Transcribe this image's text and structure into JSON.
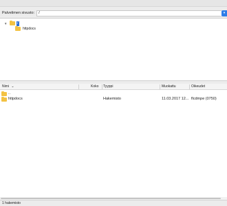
{
  "path_bar": {
    "label": "Palvelimen sivusto:",
    "value": "/",
    "dropdown_icon": "chevron-down-icon"
  },
  "tree": {
    "root_label": "/",
    "children": [
      {
        "label": "httpdocs"
      }
    ]
  },
  "listing": {
    "columns": {
      "name": "Nimi",
      "size": "Koko",
      "type": "Tyyppi",
      "modified": "Muokattu",
      "permissions": "Oikeudet"
    },
    "sort_icon": "chevron-down-icon",
    "rows": [
      {
        "name": "..",
        "size": "",
        "type": "",
        "modified": "",
        "permissions": ""
      },
      {
        "name": "httpdocs",
        "size": "",
        "type": "Hakemisto",
        "modified": "11.03.2017 12...",
        "permissions": "flcdmpe (0750)"
      }
    ]
  },
  "status": {
    "text": "1 hakemisto"
  },
  "colors": {
    "selection": "#2d6fd6",
    "folder": "#f3c243",
    "accent": "#2d7de8"
  }
}
